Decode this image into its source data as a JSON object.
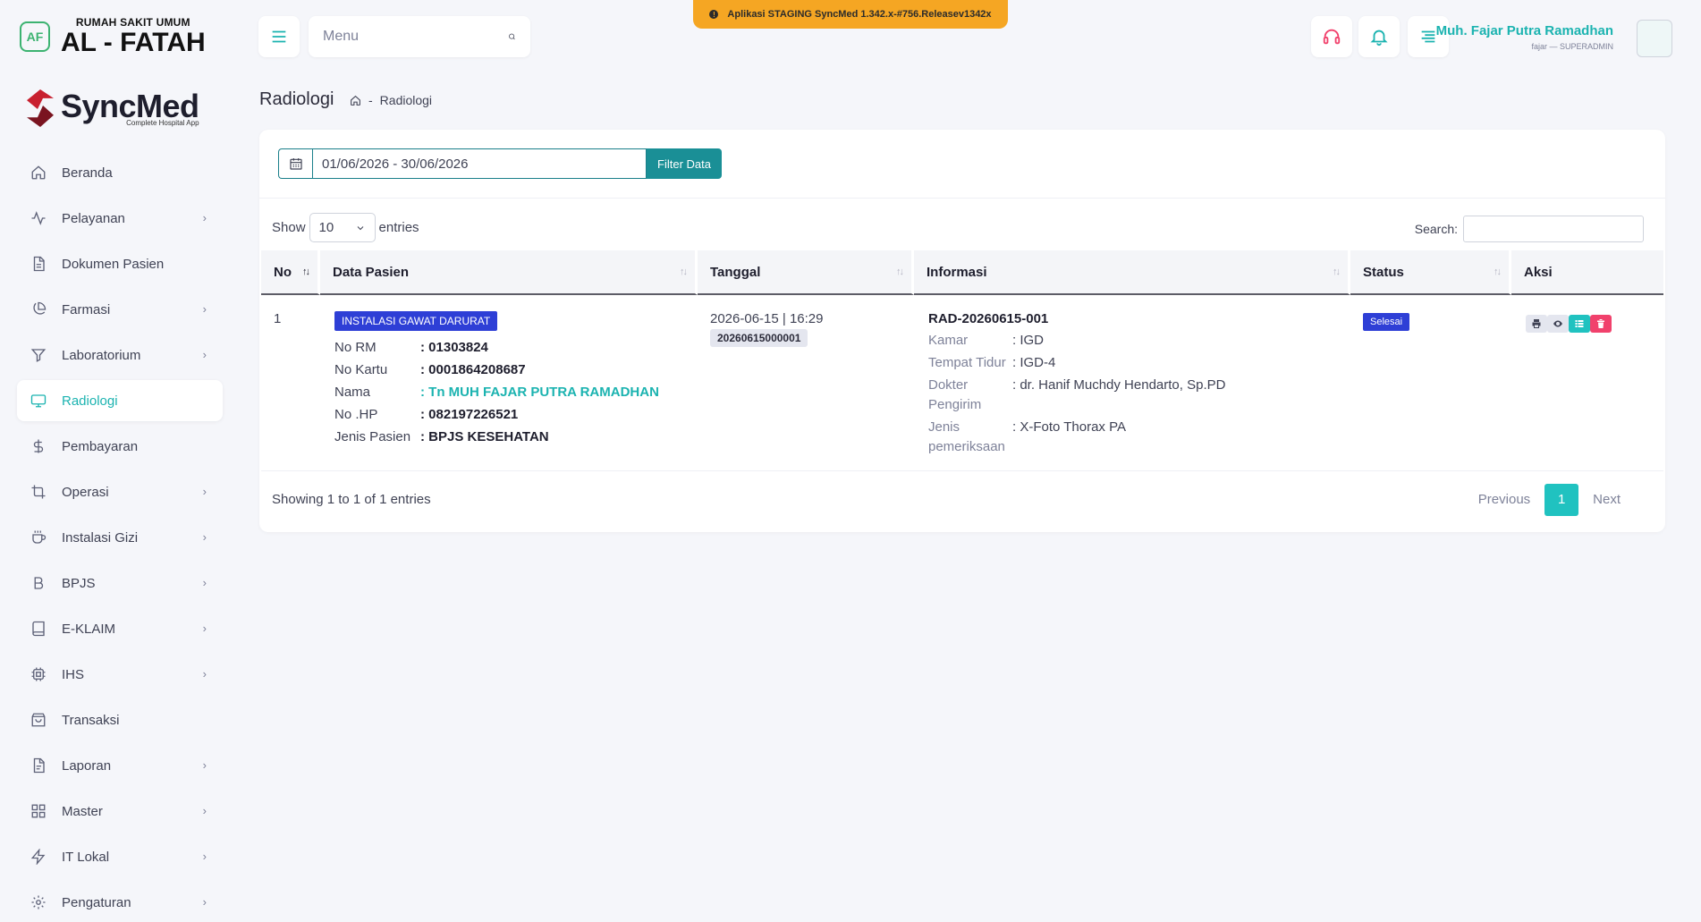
{
  "hospital": {
    "sub": "RUMAH SAKIT UMUM",
    "name": "AL - FATAH",
    "logo_text": "AF"
  },
  "brand": {
    "name": "SyncMed",
    "tagline": "Complete Hospital App"
  },
  "sidebar": {
    "items": [
      {
        "label": "Beranda",
        "icon": "home-icon",
        "chevron": false,
        "active": false
      },
      {
        "label": "Pelayanan",
        "icon": "activity-icon",
        "chevron": true,
        "active": false
      },
      {
        "label": "Dokumen Pasien",
        "icon": "document-icon",
        "chevron": false,
        "active": false
      },
      {
        "label": "Farmasi",
        "icon": "pie-chart-icon",
        "chevron": true,
        "active": false
      },
      {
        "label": "Laboratorium",
        "icon": "filter-icon",
        "chevron": true,
        "active": false
      },
      {
        "label": "Radiologi",
        "icon": "monitor-icon",
        "chevron": false,
        "active": true
      },
      {
        "label": "Pembayaran",
        "icon": "dollar-icon",
        "chevron": false,
        "active": false
      },
      {
        "label": "Operasi",
        "icon": "crop-icon",
        "chevron": true,
        "active": false
      },
      {
        "label": "Instalasi Gizi",
        "icon": "coffee-icon",
        "chevron": true,
        "active": false
      },
      {
        "label": "BPJS",
        "icon": "bold-b-icon",
        "chevron": true,
        "active": false
      },
      {
        "label": "E-KLAIM",
        "icon": "book-icon",
        "chevron": true,
        "active": false
      },
      {
        "label": "IHS",
        "icon": "cpu-icon",
        "chevron": true,
        "active": false
      },
      {
        "label": "Transaksi",
        "icon": "shopping-bag-icon",
        "chevron": false,
        "active": false
      },
      {
        "label": "Laporan",
        "icon": "file-text-icon",
        "chevron": true,
        "active": false
      },
      {
        "label": "Master",
        "icon": "grid-icon",
        "chevron": true,
        "active": false
      },
      {
        "label": "IT Lokal",
        "icon": "zap-icon",
        "chevron": true,
        "active": false
      },
      {
        "label": "Pengaturan",
        "icon": "settings-icon",
        "chevron": true,
        "active": false
      }
    ]
  },
  "topbar": {
    "search_placeholder": "Menu",
    "staging_text": "Aplikasi STAGING SyncMed 1.342.x-#756.Releasev1342x",
    "user_name": "Muh. Fajar Putra Ramadhan",
    "user_role": "fajar — SUPERADMIN"
  },
  "page": {
    "title": "Radiologi",
    "breadcrumb": "Radiologi"
  },
  "filter": {
    "date_range": "01/06/2026 - 30/06/2026",
    "button_label": "Filter Data"
  },
  "table_controls": {
    "show_label": "Show",
    "entries_label": "entries",
    "page_size": "10",
    "search_label": "Search:"
  },
  "table": {
    "columns": [
      "No",
      "Data Pasien",
      "Tanggal",
      "Informasi",
      "Status",
      "Aksi"
    ],
    "rows": [
      {
        "no": "1",
        "unit": "INSTALASI GAWAT DARURAT",
        "patient": [
          {
            "k": "No RM",
            "v": ": 01303824"
          },
          {
            "k": "No Kartu",
            "v": ": 0001864208687"
          },
          {
            "k": "Nama",
            "v": ": Tn MUH FAJAR PUTRA RAMADHAN"
          },
          {
            "k": "No .HP",
            "v": ": 082197226521"
          },
          {
            "k": "Jenis Pasien",
            "v": ": BPJS KESEHATAN"
          }
        ],
        "date": "2026-06-15 | 16:29",
        "date_code": "20260615000001",
        "rad_no": "RAD-20260615-001",
        "info": [
          {
            "k": "Kamar",
            "v": ": IGD"
          },
          {
            "k": "Tempat Tidur",
            "v": ": IGD-4"
          },
          {
            "k": "Dokter Pengirim",
            "v": ": dr. Hanif Muchdy Hendarto, Sp.PD"
          },
          {
            "k": "Jenis pemeriksaan",
            "v": ": X-Foto Thorax PA"
          }
        ],
        "status": "Selesai"
      }
    ]
  },
  "footer": {
    "info": "Showing 1 to 1 of 1 entries",
    "prev": "Previous",
    "page": "1",
    "next": "Next"
  },
  "colors": {
    "accent": "#1bb3b0",
    "primary_badge": "#2e3fd6",
    "staging": "#f5a623",
    "danger": "#f1416c"
  }
}
